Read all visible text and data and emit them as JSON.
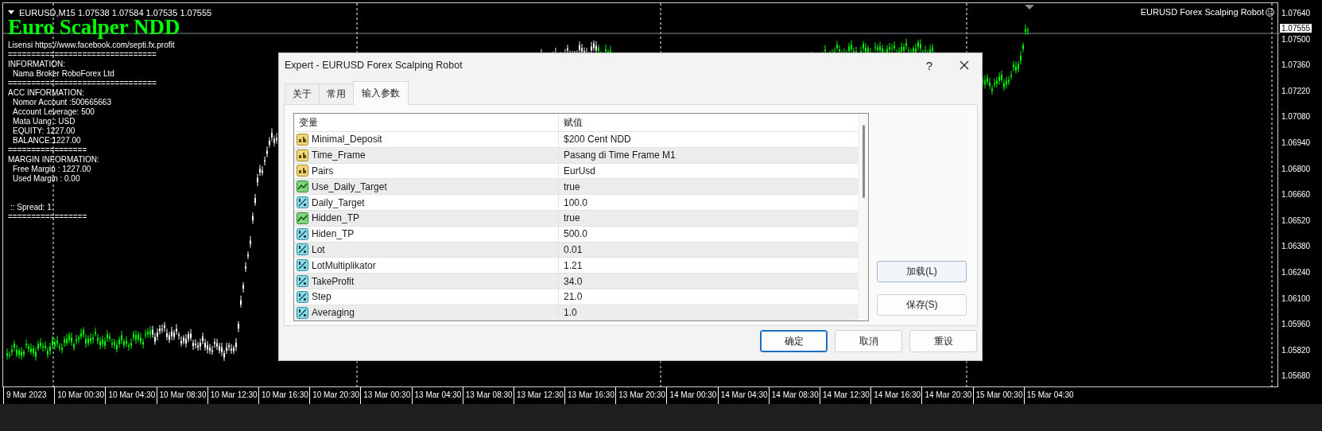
{
  "chart": {
    "symbol_line": "EURUSD,M15  1.07538 1.07584 1.07535 1.07555",
    "ea_name": "EURUSD Forex Scalping Robot",
    "current_price": "1.07555",
    "price_ticks": [
      "1.07640",
      "1.07500",
      "1.07360",
      "1.07220",
      "1.07080",
      "1.06940",
      "1.06800",
      "1.06660",
      "1.06520",
      "1.06380",
      "1.06240",
      "1.06100",
      "1.05960",
      "1.05820",
      "1.05680"
    ],
    "time_labels": [
      "9 Mar 2023",
      "10 Mar 00:30",
      "10 Mar 04:30",
      "10 Mar 08:30",
      "10 Mar 12:30",
      "10 Mar 16:30",
      "10 Mar 20:30",
      "13 Mar 00:30",
      "13 Mar 04:30",
      "13 Mar 08:30",
      "13 Mar 12:30",
      "13 Mar 16:30",
      "13 Mar 20:30",
      "14 Mar 00:30",
      "14 Mar 04:30",
      "14 Mar 08:30",
      "14 Mar 12:30",
      "14 Mar 16:30",
      "14 Mar 20:30",
      "15 Mar 00:30",
      "15 Mar 04:30"
    ]
  },
  "info_panel": {
    "title": "Euro Scalper NDD",
    "lines": [
      {
        "kind": "heading",
        "text": "Lisensi https://www.facebook.com/septi.fx.profit"
      },
      {
        "kind": "heading",
        "text": "================================"
      },
      {
        "kind": "heading",
        "text": "INFORMATION:"
      },
      {
        "kind": "item",
        "text": "Nama Broker RoboForex Ltd"
      },
      {
        "kind": "heading",
        "text": "================================"
      },
      {
        "kind": "heading",
        "text": "ACC INFORMATION:"
      },
      {
        "kind": "item",
        "text": "Nomor Account :500665663"
      },
      {
        "kind": "item",
        "text": "Account Leverage: 500"
      },
      {
        "kind": "item",
        "text": "Mata Uang : USD"
      },
      {
        "kind": "item",
        "text": "EQUITY: 1227.00"
      },
      {
        "kind": "item",
        "text": "BALANCE:1227.00"
      },
      {
        "kind": "heading",
        "text": "================="
      },
      {
        "kind": "heading",
        "text": "MARGIN INFORMATION:"
      },
      {
        "kind": "item",
        "text": "Free Margin : 1227.00"
      },
      {
        "kind": "item",
        "text": "Used Margin : 0.00"
      },
      {
        "kind": "spread",
        "text": ":: Spread: 1"
      },
      {
        "kind": "heading",
        "text": "================="
      }
    ]
  },
  "dialog": {
    "title": "Expert - EURUSD Forex Scalping Robot",
    "help": "?",
    "tabs": [
      {
        "label": "关于",
        "selected": false
      },
      {
        "label": "常用",
        "selected": false
      },
      {
        "label": "输入参数",
        "selected": true
      }
    ],
    "columns": [
      "变量",
      "赋值"
    ],
    "rows": [
      {
        "kind": "string",
        "name": "Minimal_Deposit",
        "value": "$200 Cent NDD"
      },
      {
        "kind": "string",
        "name": "Time_Frame",
        "value": "Pasang di Time Frame M1"
      },
      {
        "kind": "string",
        "name": "Pairs",
        "value": "EurUsd"
      },
      {
        "kind": "bool",
        "name": "Use_Daily_Target",
        "value": "true"
      },
      {
        "kind": "number",
        "name": "Daily_Target",
        "value": "100.0"
      },
      {
        "kind": "bool",
        "name": "Hidden_TP",
        "value": "true"
      },
      {
        "kind": "number",
        "name": "Hiden_TP",
        "value": "500.0"
      },
      {
        "kind": "number",
        "name": "Lot",
        "value": "0.01"
      },
      {
        "kind": "number",
        "name": "LotMultiplikator",
        "value": "1.21"
      },
      {
        "kind": "number",
        "name": "TakeProfit",
        "value": "34.0"
      },
      {
        "kind": "number",
        "name": "Step",
        "value": "21.0"
      },
      {
        "kind": "number",
        "name": "Averaging",
        "value": "1.0"
      }
    ],
    "side_buttons": [
      {
        "label": "加载(L)",
        "focused": true
      },
      {
        "label": "保存(S)",
        "focused": false
      }
    ],
    "buttons": [
      {
        "label": "确定",
        "default": true
      },
      {
        "label": "取消",
        "default": false
      },
      {
        "label": "重设",
        "default": false
      }
    ]
  }
}
